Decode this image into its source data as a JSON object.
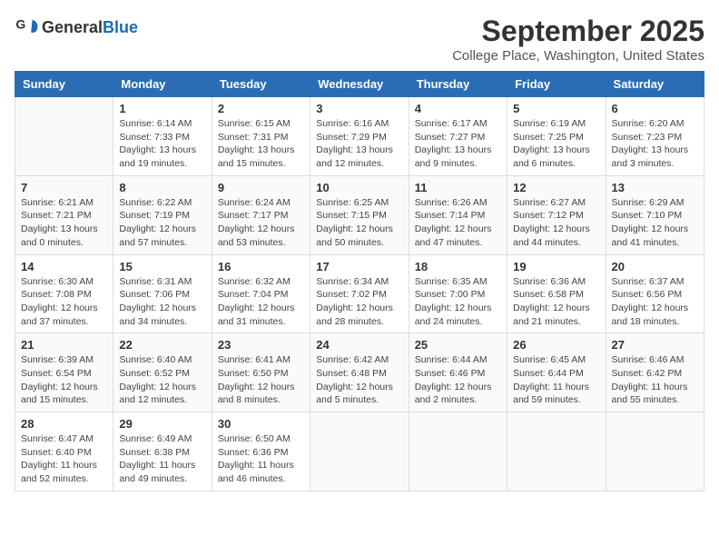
{
  "header": {
    "logo_general": "General",
    "logo_blue": "Blue",
    "title": "September 2025",
    "subtitle": "College Place, Washington, United States"
  },
  "days_of_week": [
    "Sunday",
    "Monday",
    "Tuesday",
    "Wednesday",
    "Thursday",
    "Friday",
    "Saturday"
  ],
  "weeks": [
    [
      {
        "day": "",
        "info": ""
      },
      {
        "day": "1",
        "info": "Sunrise: 6:14 AM\nSunset: 7:33 PM\nDaylight: 13 hours\nand 19 minutes."
      },
      {
        "day": "2",
        "info": "Sunrise: 6:15 AM\nSunset: 7:31 PM\nDaylight: 13 hours\nand 15 minutes."
      },
      {
        "day": "3",
        "info": "Sunrise: 6:16 AM\nSunset: 7:29 PM\nDaylight: 13 hours\nand 12 minutes."
      },
      {
        "day": "4",
        "info": "Sunrise: 6:17 AM\nSunset: 7:27 PM\nDaylight: 13 hours\nand 9 minutes."
      },
      {
        "day": "5",
        "info": "Sunrise: 6:19 AM\nSunset: 7:25 PM\nDaylight: 13 hours\nand 6 minutes."
      },
      {
        "day": "6",
        "info": "Sunrise: 6:20 AM\nSunset: 7:23 PM\nDaylight: 13 hours\nand 3 minutes."
      }
    ],
    [
      {
        "day": "7",
        "info": "Sunrise: 6:21 AM\nSunset: 7:21 PM\nDaylight: 13 hours\nand 0 minutes."
      },
      {
        "day": "8",
        "info": "Sunrise: 6:22 AM\nSunset: 7:19 PM\nDaylight: 12 hours\nand 57 minutes."
      },
      {
        "day": "9",
        "info": "Sunrise: 6:24 AM\nSunset: 7:17 PM\nDaylight: 12 hours\nand 53 minutes."
      },
      {
        "day": "10",
        "info": "Sunrise: 6:25 AM\nSunset: 7:15 PM\nDaylight: 12 hours\nand 50 minutes."
      },
      {
        "day": "11",
        "info": "Sunrise: 6:26 AM\nSunset: 7:14 PM\nDaylight: 12 hours\nand 47 minutes."
      },
      {
        "day": "12",
        "info": "Sunrise: 6:27 AM\nSunset: 7:12 PM\nDaylight: 12 hours\nand 44 minutes."
      },
      {
        "day": "13",
        "info": "Sunrise: 6:29 AM\nSunset: 7:10 PM\nDaylight: 12 hours\nand 41 minutes."
      }
    ],
    [
      {
        "day": "14",
        "info": "Sunrise: 6:30 AM\nSunset: 7:08 PM\nDaylight: 12 hours\nand 37 minutes."
      },
      {
        "day": "15",
        "info": "Sunrise: 6:31 AM\nSunset: 7:06 PM\nDaylight: 12 hours\nand 34 minutes."
      },
      {
        "day": "16",
        "info": "Sunrise: 6:32 AM\nSunset: 7:04 PM\nDaylight: 12 hours\nand 31 minutes."
      },
      {
        "day": "17",
        "info": "Sunrise: 6:34 AM\nSunset: 7:02 PM\nDaylight: 12 hours\nand 28 minutes."
      },
      {
        "day": "18",
        "info": "Sunrise: 6:35 AM\nSunset: 7:00 PM\nDaylight: 12 hours\nand 24 minutes."
      },
      {
        "day": "19",
        "info": "Sunrise: 6:36 AM\nSunset: 6:58 PM\nDaylight: 12 hours\nand 21 minutes."
      },
      {
        "day": "20",
        "info": "Sunrise: 6:37 AM\nSunset: 6:56 PM\nDaylight: 12 hours\nand 18 minutes."
      }
    ],
    [
      {
        "day": "21",
        "info": "Sunrise: 6:39 AM\nSunset: 6:54 PM\nDaylight: 12 hours\nand 15 minutes."
      },
      {
        "day": "22",
        "info": "Sunrise: 6:40 AM\nSunset: 6:52 PM\nDaylight: 12 hours\nand 12 minutes."
      },
      {
        "day": "23",
        "info": "Sunrise: 6:41 AM\nSunset: 6:50 PM\nDaylight: 12 hours\nand 8 minutes."
      },
      {
        "day": "24",
        "info": "Sunrise: 6:42 AM\nSunset: 6:48 PM\nDaylight: 12 hours\nand 5 minutes."
      },
      {
        "day": "25",
        "info": "Sunrise: 6:44 AM\nSunset: 6:46 PM\nDaylight: 12 hours\nand 2 minutes."
      },
      {
        "day": "26",
        "info": "Sunrise: 6:45 AM\nSunset: 6:44 PM\nDaylight: 11 hours\nand 59 minutes."
      },
      {
        "day": "27",
        "info": "Sunrise: 6:46 AM\nSunset: 6:42 PM\nDaylight: 11 hours\nand 55 minutes."
      }
    ],
    [
      {
        "day": "28",
        "info": "Sunrise: 6:47 AM\nSunset: 6:40 PM\nDaylight: 11 hours\nand 52 minutes."
      },
      {
        "day": "29",
        "info": "Sunrise: 6:49 AM\nSunset: 6:38 PM\nDaylight: 11 hours\nand 49 minutes."
      },
      {
        "day": "30",
        "info": "Sunrise: 6:50 AM\nSunset: 6:36 PM\nDaylight: 11 hours\nand 46 minutes."
      },
      {
        "day": "",
        "info": ""
      },
      {
        "day": "",
        "info": ""
      },
      {
        "day": "",
        "info": ""
      },
      {
        "day": "",
        "info": ""
      }
    ]
  ]
}
